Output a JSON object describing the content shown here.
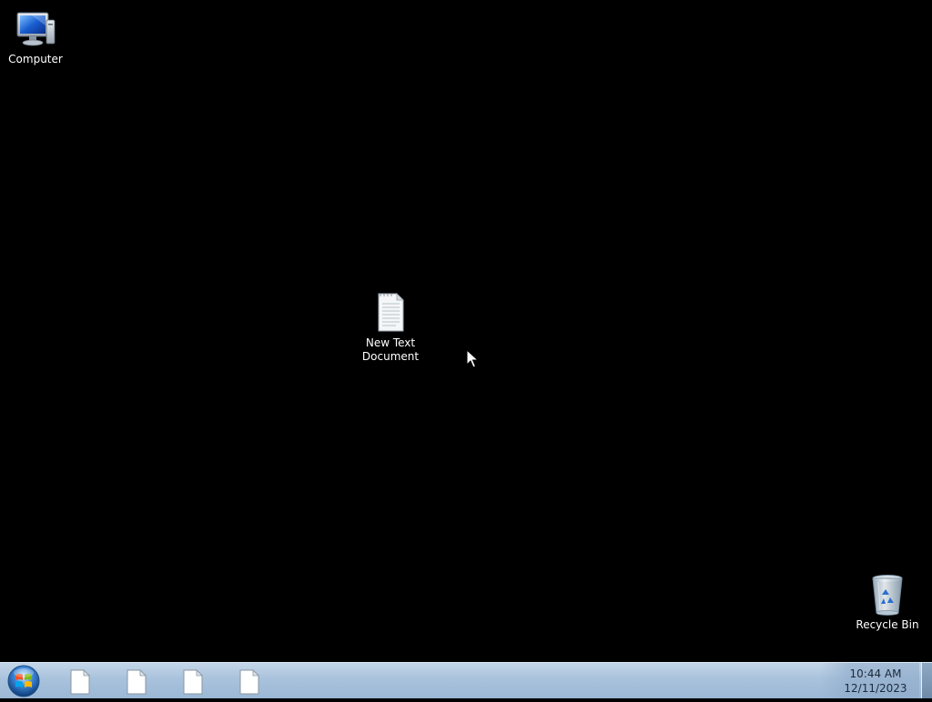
{
  "desktop": {
    "background_color": "#000000",
    "icons": [
      {
        "name": "computer",
        "label": "Computer",
        "icon": "computer-icon"
      },
      {
        "name": "new-text-document",
        "label_line1": "New Text",
        "label_line2": "Document",
        "icon": "text-document-icon"
      },
      {
        "name": "recycle-bin",
        "label": "Recycle Bin",
        "icon": "recycle-bin-icon"
      }
    ]
  },
  "taskbar": {
    "color": "#a9c2dc",
    "start_icon": "windows-start-orb-icon",
    "buttons": [
      {
        "icon": "text-document-icon"
      },
      {
        "icon": "text-document-icon"
      },
      {
        "icon": "text-document-icon"
      },
      {
        "icon": "text-document-icon"
      }
    ],
    "clock": {
      "time": "10:44 AM",
      "date": "12/11/2023"
    }
  }
}
